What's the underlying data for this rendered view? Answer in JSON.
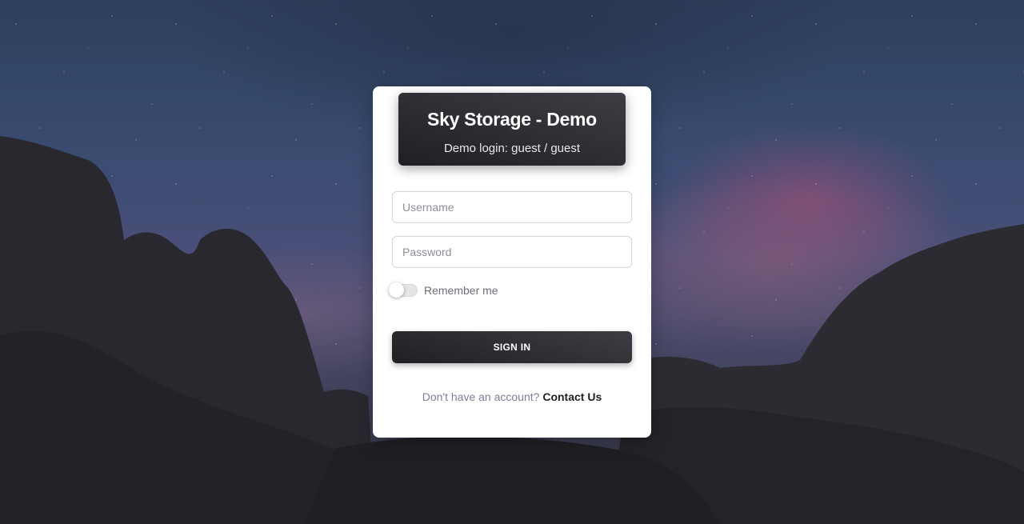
{
  "header": {
    "title": "Sky Storage - Demo",
    "subtitle": "Demo login: guest / guest"
  },
  "form": {
    "username_placeholder": "Username",
    "username_value": "",
    "password_placeholder": "Password",
    "password_value": "",
    "remember_label": "Remember me",
    "remember_checked": false,
    "submit_label": "SIGN IN"
  },
  "footer": {
    "prompt": "Don't have an account?",
    "link_label": "Contact Us"
  }
}
